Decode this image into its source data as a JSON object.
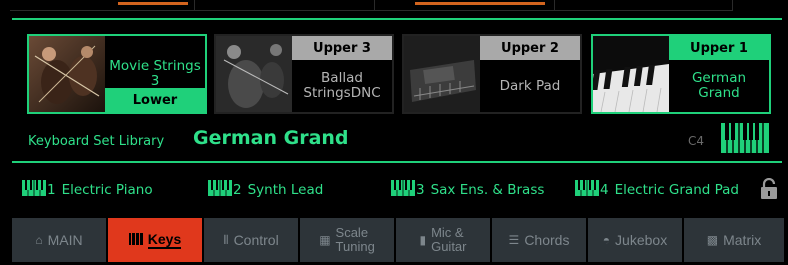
{
  "colors": {
    "accent": "#1fd07a",
    "text_accent": "#2fe08a",
    "active_tab": "#e0381c",
    "tab_bg": "#2d3439",
    "header_gray": "#a9a9a9"
  },
  "keyboard_slots": [
    {
      "header": "Lower",
      "sound": "Movie Strings 3",
      "active": true,
      "image": "violin-photo"
    },
    {
      "header": "Upper 3",
      "sound": "Ballad StringsDNC",
      "active": false,
      "image": "strings-photo"
    },
    {
      "header": "Upper 2",
      "sound": "Dark Pad",
      "active": false,
      "image": "synth-photo"
    },
    {
      "header": "Upper 1",
      "sound": "German Grand",
      "active": true,
      "image": "piano-photo"
    }
  ],
  "library": {
    "label": "Keyboard Set Library",
    "value": "German Grand",
    "note": "C4",
    "icon": "keyboard-icon"
  },
  "split_points": [
    {
      "num": "1",
      "name": "Electric Piano"
    },
    {
      "num": "2",
      "name": "Synth Lead"
    },
    {
      "num": "3",
      "name": "Sax Ens. & Brass"
    },
    {
      "num": "4",
      "name": "Electric Grand Pad"
    }
  ],
  "lock_icon": "lock-icon",
  "tabs": [
    {
      "label": "MAIN",
      "icon": "home-icon",
      "active": false
    },
    {
      "label": "Keys",
      "icon": "keys-icon",
      "active": true
    },
    {
      "label": "Control",
      "icon": "sliders-icon",
      "active": false
    },
    {
      "label": "Scale",
      "label2": "Tuning",
      "icon": "scale-icon",
      "active": false
    },
    {
      "label": "Mic &",
      "label2": "Guitar",
      "icon": "mic-icon",
      "active": false
    },
    {
      "label": "Chords",
      "icon": "chords-icon",
      "active": false
    },
    {
      "label": "Jukebox",
      "icon": "jukebox-icon",
      "active": false
    },
    {
      "label": "Matrix",
      "icon": "grid-icon",
      "active": false
    }
  ]
}
